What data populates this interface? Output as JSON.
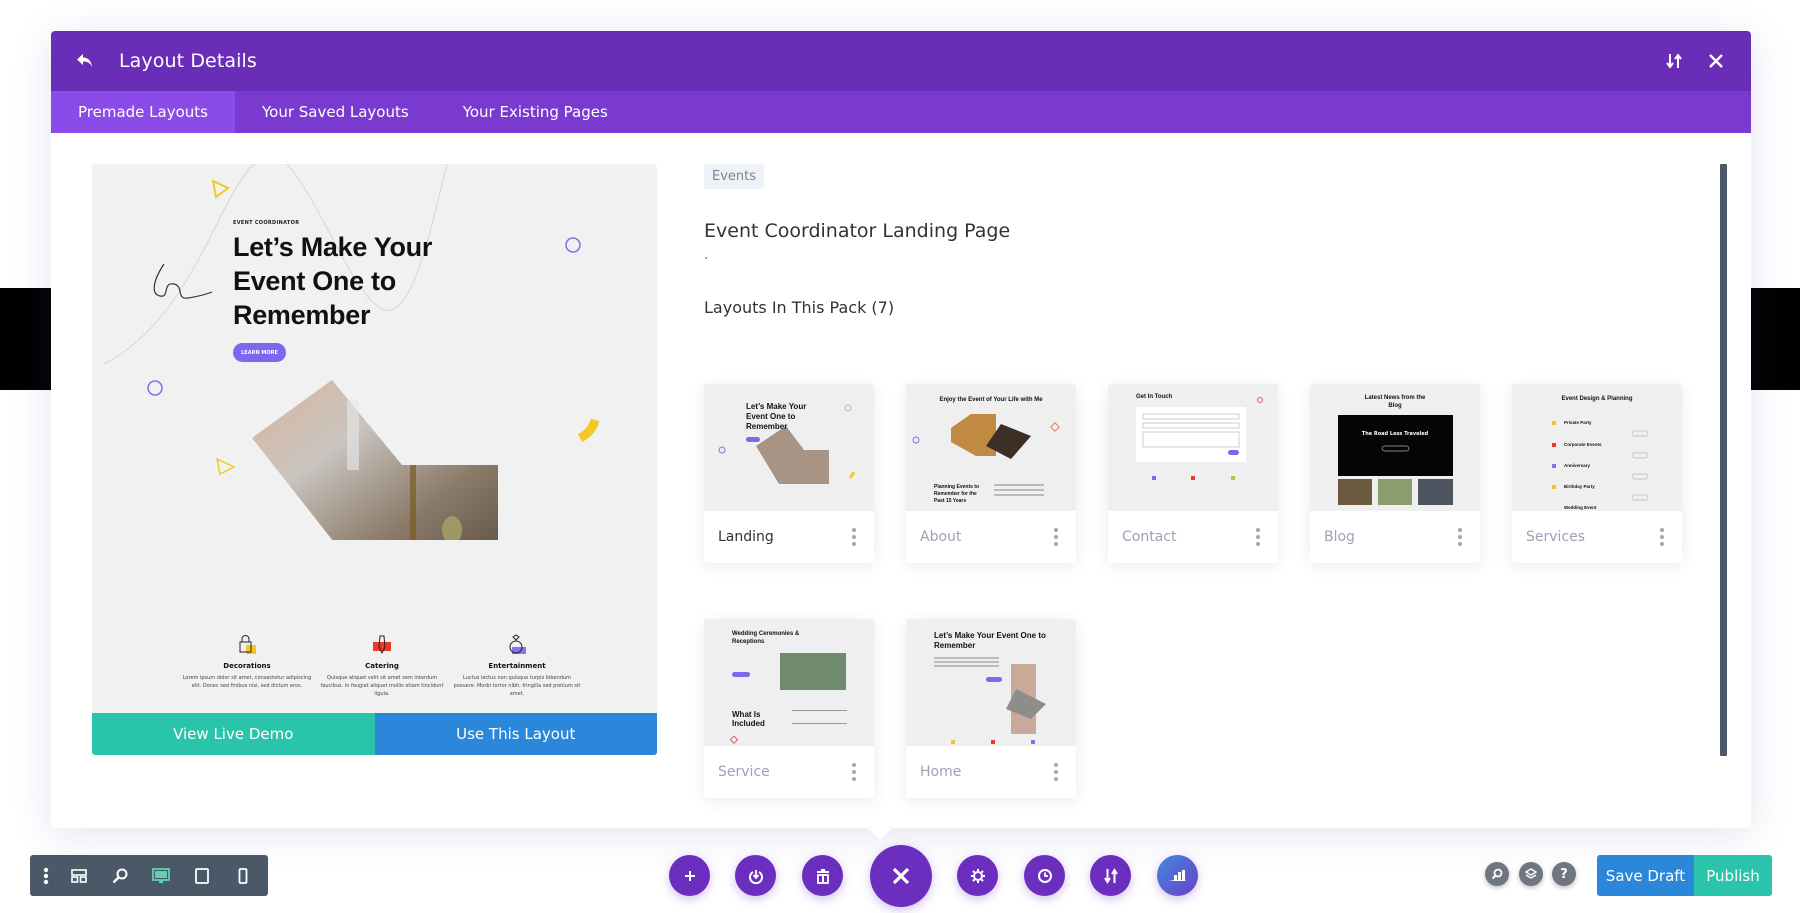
{
  "header": {
    "title": "Layout Details",
    "back_icon": "undo-arrow-icon",
    "sort_icon": "sort-arrows-icon",
    "close_icon": "close-icon"
  },
  "tabs": [
    {
      "label": "Premade Layouts",
      "active": true
    },
    {
      "label": "Your Saved Layouts",
      "active": false
    },
    {
      "label": "Your Existing Pages",
      "active": false
    }
  ],
  "preview": {
    "kicker": "EVENT COORDINATOR",
    "headline_lines": [
      "Let’s Make Your",
      "Event One to",
      "Remember"
    ],
    "learn_more": "LEARN MORE",
    "features": [
      {
        "name": "Decorations",
        "desc": "Lorem ipsum dolor sit amet, consectetur adipiscing elit. Donec sed finibus nisi, sed dictum eros.",
        "icon": "lock-icon",
        "accent": "#f3c623"
      },
      {
        "name": "Catering",
        "desc": "Quisque aliquet velit sit amet sem interdum faucibus. In feugiat aliquet mollis etiam tincidunt ligula.",
        "icon": "tie-icon",
        "accent": "#e63b2e"
      },
      {
        "name": "Entertainment",
        "desc": "Luctus lectus non quisque turpis bibendum posuere. Morbi tortor nibh, fringilla sed pretium sit amet.",
        "icon": "ring-icon",
        "accent": "#8a6ff0"
      }
    ],
    "view_demo_label": "View Live Demo",
    "use_layout_label": "Use This Layout"
  },
  "details": {
    "category": "Events",
    "title": "Event Coordinator Landing Page",
    "description": ".",
    "pack_title": "Layouts In This Pack (7)"
  },
  "layouts": [
    {
      "name": "Landing",
      "active": true,
      "thumb_title": "Let’s Make Your Event One to Remember"
    },
    {
      "name": "About",
      "active": false,
      "thumb_title": "Enjoy the Event of Your Life with Me",
      "thumb_sub": "Planning Events to Remember for the Past 15 Years"
    },
    {
      "name": "Contact",
      "active": false,
      "thumb_title": "Get In Touch"
    },
    {
      "name": "Blog",
      "active": false,
      "thumb_title": "Latest News from the Blog",
      "thumb_sub": "The Road Less Traveled"
    },
    {
      "name": "Services",
      "active": false,
      "thumb_title": "Event Design & Planning",
      "thumb_items": [
        "Private Party",
        "Corporate Events",
        "Anniversary",
        "Birthday Party",
        "Wedding Event"
      ]
    },
    {
      "name": "Service",
      "active": false,
      "thumb_title": "Wedding Ceremonies & Receptions",
      "thumb_sub": "What Is Included"
    },
    {
      "name": "Home",
      "active": false,
      "thumb_title": "Let’s Make Your Event One to Remember"
    }
  ],
  "left_toolbar": [
    {
      "icon": "kebab-menu-icon"
    },
    {
      "icon": "wireframe-icon"
    },
    {
      "icon": "zoom-icon"
    },
    {
      "icon": "desktop-icon",
      "active": true
    },
    {
      "icon": "tablet-icon"
    },
    {
      "icon": "phone-icon"
    }
  ],
  "center_toolbar": [
    {
      "icon": "plus-icon"
    },
    {
      "icon": "power-icon"
    },
    {
      "icon": "trash-icon"
    },
    {
      "icon": "close-icon"
    },
    {
      "icon": "gear-icon"
    },
    {
      "icon": "history-icon"
    },
    {
      "icon": "sort-arrows-icon"
    },
    {
      "icon": "ai-chart-icon"
    }
  ],
  "right_tools": [
    {
      "icon": "search-icon"
    },
    {
      "icon": "layers-icon"
    },
    {
      "icon": "help-icon",
      "glyph": "?"
    }
  ],
  "save_draft_label": "Save Draft",
  "publish_label": "Publish",
  "colors": {
    "header": "#6a2db8",
    "tabs": "#7a3ad0",
    "tab_active": "#8b4be8",
    "demo_button": "#29c4a9",
    "use_button": "#2b87da",
    "save_draft": "#2b87da",
    "publish": "#29c4a9",
    "toolbar_dark": "#4b5867"
  }
}
